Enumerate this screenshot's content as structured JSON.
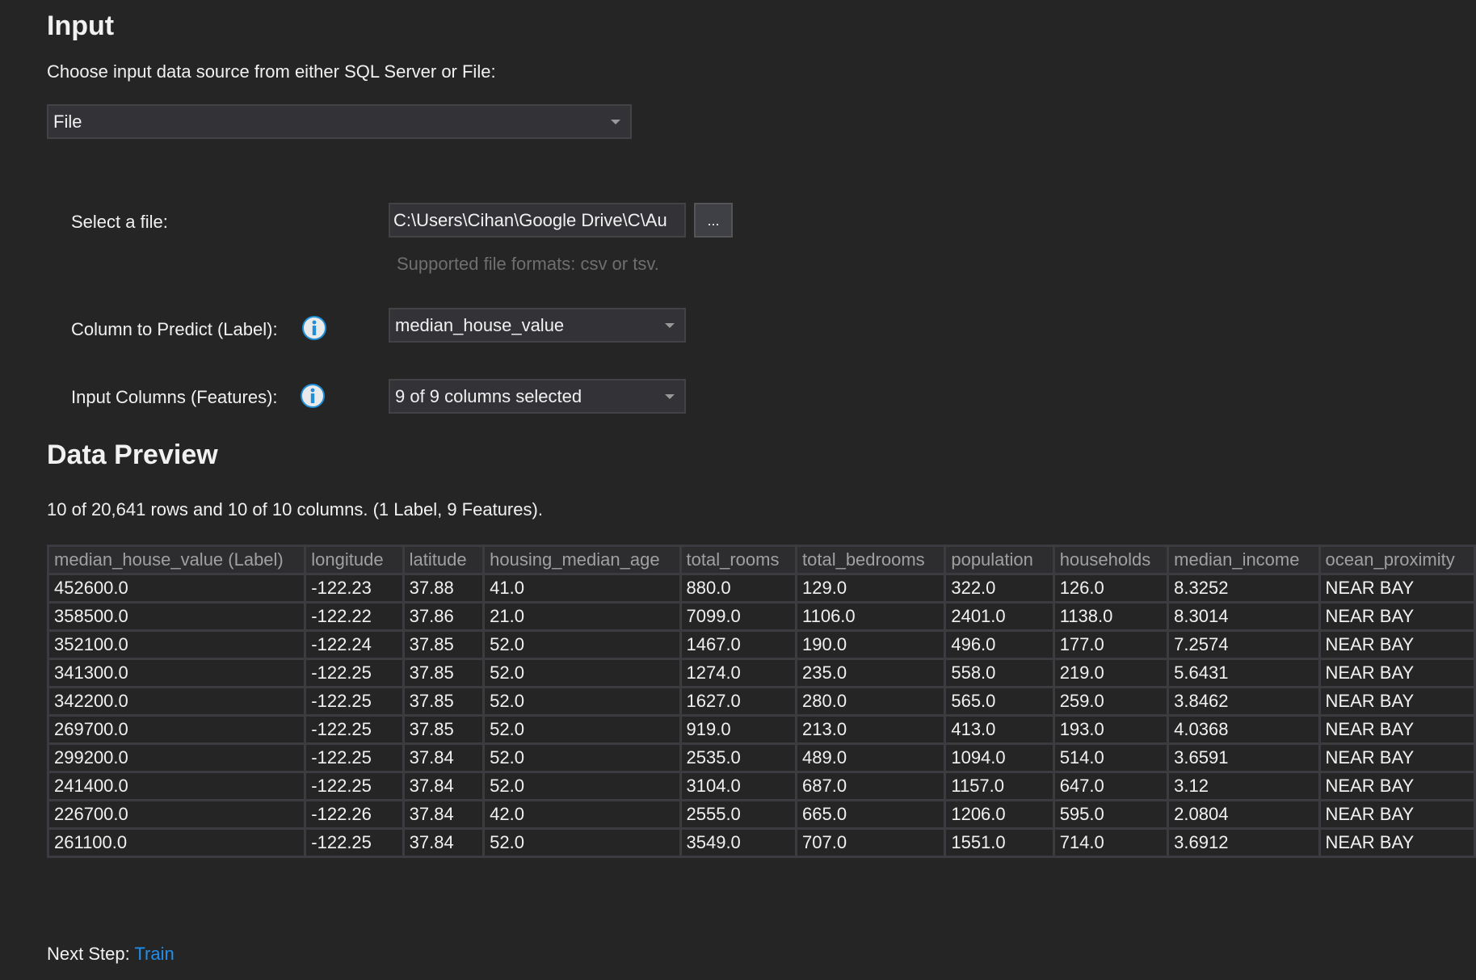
{
  "input_section": {
    "title": "Input",
    "description": "Choose input data source from either SQL Server or File:",
    "source_dropdown": {
      "selected": "File",
      "icon": "chevron-down-icon"
    },
    "select_file": {
      "label": "Select a file:",
      "value": "C:\\Users\\Cihan\\Google Drive\\C\\Au",
      "browse_label": "...",
      "hint": "Supported file formats: csv or tsv."
    },
    "label_column": {
      "label": "Column to Predict (Label):",
      "info_icon": "info-icon",
      "selected": "median_house_value"
    },
    "feature_columns": {
      "label": "Input Columns (Features):",
      "info_icon": "info-icon",
      "selected": "9 of 9 columns selected"
    }
  },
  "data_preview": {
    "title": "Data Preview",
    "summary": "10 of 20,641 rows and 10 of 10 columns. (1 Label, 9 Features).",
    "columns": [
      "median_house_value (Label)",
      "longitude",
      "latitude",
      "housing_median_age",
      "total_rooms",
      "total_bedrooms",
      "population",
      "households",
      "median_income",
      "ocean_proximity"
    ],
    "rows": [
      [
        "452600.0",
        "-122.23",
        "37.88",
        "41.0",
        "880.0",
        "129.0",
        "322.0",
        "126.0",
        "8.3252",
        "NEAR BAY"
      ],
      [
        "358500.0",
        "-122.22",
        "37.86",
        "21.0",
        "7099.0",
        "1106.0",
        "2401.0",
        "1138.0",
        "8.3014",
        "NEAR BAY"
      ],
      [
        "352100.0",
        "-122.24",
        "37.85",
        "52.0",
        "1467.0",
        "190.0",
        "496.0",
        "177.0",
        "7.2574",
        "NEAR BAY"
      ],
      [
        "341300.0",
        "-122.25",
        "37.85",
        "52.0",
        "1274.0",
        "235.0",
        "558.0",
        "219.0",
        "5.6431",
        "NEAR BAY"
      ],
      [
        "342200.0",
        "-122.25",
        "37.85",
        "52.0",
        "1627.0",
        "280.0",
        "565.0",
        "259.0",
        "3.8462",
        "NEAR BAY"
      ],
      [
        "269700.0",
        "-122.25",
        "37.85",
        "52.0",
        "919.0",
        "213.0",
        "413.0",
        "193.0",
        "4.0368",
        "NEAR BAY"
      ],
      [
        "299200.0",
        "-122.25",
        "37.84",
        "52.0",
        "2535.0",
        "489.0",
        "1094.0",
        "514.0",
        "3.6591",
        "NEAR BAY"
      ],
      [
        "241400.0",
        "-122.25",
        "37.84",
        "52.0",
        "3104.0",
        "687.0",
        "1157.0",
        "647.0",
        "3.12",
        "NEAR BAY"
      ],
      [
        "226700.0",
        "-122.26",
        "37.84",
        "42.0",
        "2555.0",
        "665.0",
        "1206.0",
        "595.0",
        "2.0804",
        "NEAR BAY"
      ],
      [
        "261100.0",
        "-122.25",
        "37.84",
        "52.0",
        "3549.0",
        "707.0",
        "1551.0",
        "714.0",
        "3.6912",
        "NEAR BAY"
      ]
    ]
  },
  "footer": {
    "next_step_label": "Next Step:",
    "next_step_link": "Train"
  },
  "colors": {
    "background": "#252526",
    "accent_link": "#1e90ef",
    "info_icon_blue": "#1e8fd8"
  }
}
